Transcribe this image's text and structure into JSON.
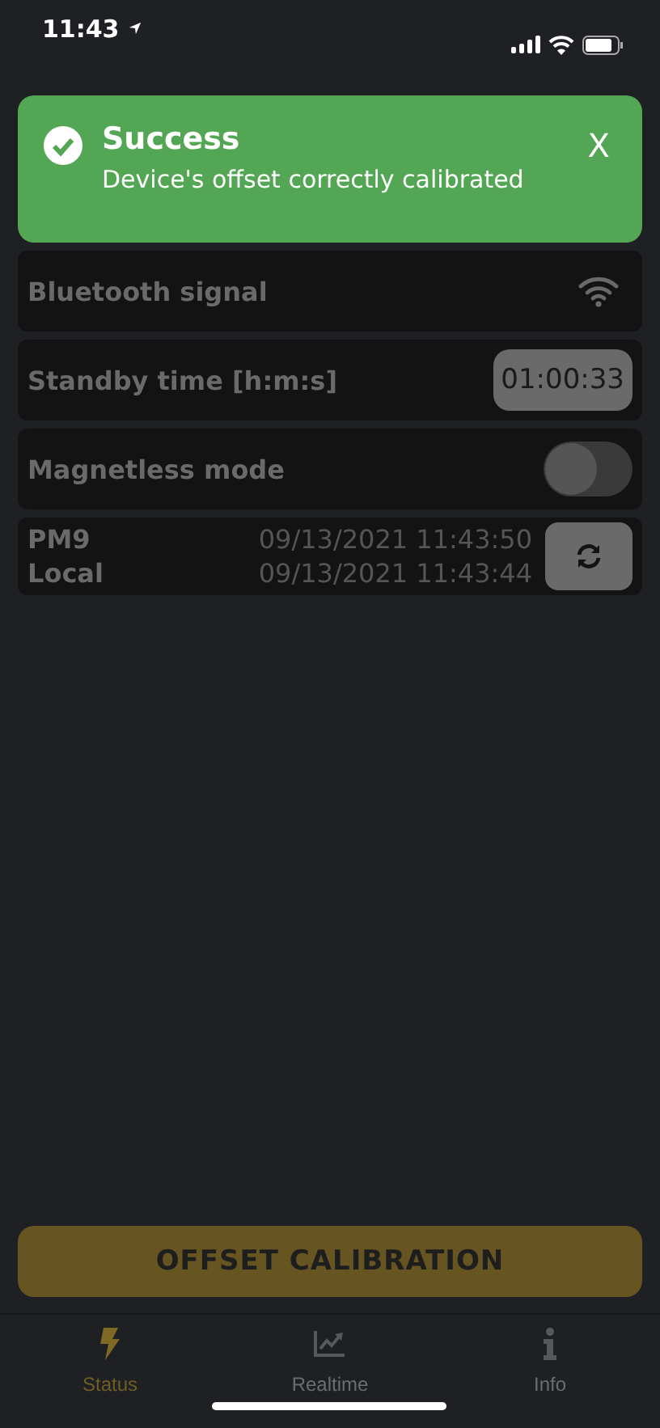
{
  "status_bar": {
    "time": "11:43"
  },
  "toast": {
    "title": "Success",
    "message": "Device's offset correctly calibrated",
    "close": "X"
  },
  "rows": [
    {
      "kind": "signal",
      "label": "Bluetooth signal"
    },
    {
      "kind": "value",
      "label": "Standby time [h:m:s]",
      "value": "01:00:33"
    },
    {
      "kind": "toggle",
      "label": "Magnetless mode",
      "on": false
    }
  ],
  "clock": {
    "lines": [
      {
        "label": "PM9",
        "value": "09/13/2021 11:43:50"
      },
      {
        "label": "Local",
        "value": "09/13/2021 11:43:44"
      }
    ]
  },
  "action_button": "OFFSET CALIBRATION",
  "tabs": [
    {
      "kind": "bolt",
      "label": "Status",
      "selected": true
    },
    {
      "kind": "chart",
      "label": "Realtime",
      "selected": false
    },
    {
      "kind": "info",
      "label": "Info",
      "selected": false
    }
  ]
}
